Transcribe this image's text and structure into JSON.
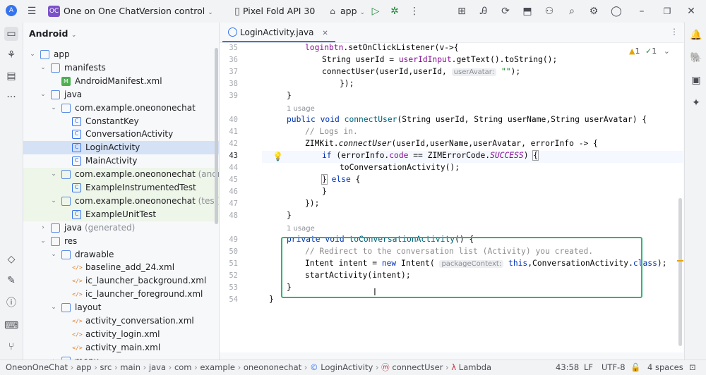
{
  "titlebar": {
    "project_badge": "OC",
    "project_name": "One on One Chat",
    "vcs": "Version control",
    "device": "Pixel Fold API 30",
    "run_config": "app"
  },
  "project_panel": {
    "title": "Android",
    "tree": [
      {
        "label": "app",
        "indent": 0,
        "arrow": "down",
        "icon": "module"
      },
      {
        "label": "manifests",
        "indent": 1,
        "arrow": "down",
        "icon": "folder"
      },
      {
        "label": "AndroidManifest.xml",
        "indent": 2,
        "arrow": "",
        "icon": "manifest"
      },
      {
        "label": "java",
        "indent": 1,
        "arrow": "down",
        "icon": "folder"
      },
      {
        "label": "com.example.oneononechat",
        "indent": 2,
        "arrow": "down",
        "icon": "package"
      },
      {
        "label": "ConstantKey",
        "indent": 3,
        "arrow": "",
        "icon": "class"
      },
      {
        "label": "ConversationActivity",
        "indent": 3,
        "arrow": "",
        "icon": "class"
      },
      {
        "label": "LoginActivity",
        "indent": 3,
        "arrow": "",
        "icon": "class",
        "selected": true
      },
      {
        "label": "MainActivity",
        "indent": 3,
        "arrow": "",
        "icon": "class"
      },
      {
        "label": "com.example.oneononechat",
        "suffix": "(androidTest)",
        "indent": 2,
        "arrow": "down",
        "icon": "package",
        "green": true
      },
      {
        "label": "ExampleInstrumentedTest",
        "indent": 3,
        "arrow": "",
        "icon": "class",
        "green": true
      },
      {
        "label": "com.example.oneononechat",
        "suffix": "(test)",
        "indent": 2,
        "arrow": "down",
        "icon": "package",
        "green": true
      },
      {
        "label": "ExampleUnitTest",
        "indent": 3,
        "arrow": "",
        "icon": "class",
        "green": true
      },
      {
        "label": "java",
        "suffix": "(generated)",
        "indent": 1,
        "arrow": "right",
        "icon": "folder"
      },
      {
        "label": "res",
        "indent": 1,
        "arrow": "down",
        "icon": "folder"
      },
      {
        "label": "drawable",
        "indent": 2,
        "arrow": "down",
        "icon": "folder"
      },
      {
        "label": "baseline_add_24.xml",
        "indent": 3,
        "arrow": "",
        "icon": "xml"
      },
      {
        "label": "ic_launcher_background.xml",
        "indent": 3,
        "arrow": "",
        "icon": "xml"
      },
      {
        "label": "ic_launcher_foreground.xml",
        "indent": 3,
        "arrow": "",
        "icon": "xml"
      },
      {
        "label": "layout",
        "indent": 2,
        "arrow": "down",
        "icon": "folder"
      },
      {
        "label": "activity_conversation.xml",
        "indent": 3,
        "arrow": "",
        "icon": "xml"
      },
      {
        "label": "activity_login.xml",
        "indent": 3,
        "arrow": "",
        "icon": "xml"
      },
      {
        "label": "activity_main.xml",
        "indent": 3,
        "arrow": "",
        "icon": "xml"
      },
      {
        "label": "menu",
        "indent": 2,
        "arrow": "right",
        "icon": "folder"
      }
    ]
  },
  "editor": {
    "tab_label": "LoginActivity.java",
    "inspection_warn": "1",
    "inspection_ok": "1",
    "usage_label_1": "1 usage",
    "usage_label_2": "1 usage",
    "hint_user_avatar": "userAvatar:",
    "hint_package_context": "packageContext:",
    "line_numbers": [
      "35",
      "36",
      "37",
      "38",
      "39",
      "40",
      "41",
      "42",
      "43",
      "44",
      "45",
      "46",
      "47",
      "48",
      "49",
      "50",
      "51",
      "52",
      "53",
      "54"
    ]
  },
  "statusbar": {
    "breadcrumb": [
      "OneonOneChat",
      "app",
      "src",
      "main",
      "java",
      "com",
      "example",
      "oneononechat",
      "LoginActivity",
      "connectUser",
      "Lambda"
    ],
    "position": "43:58",
    "line_sep": "LF",
    "encoding": "UTF-8",
    "indent": "4 spaces"
  }
}
